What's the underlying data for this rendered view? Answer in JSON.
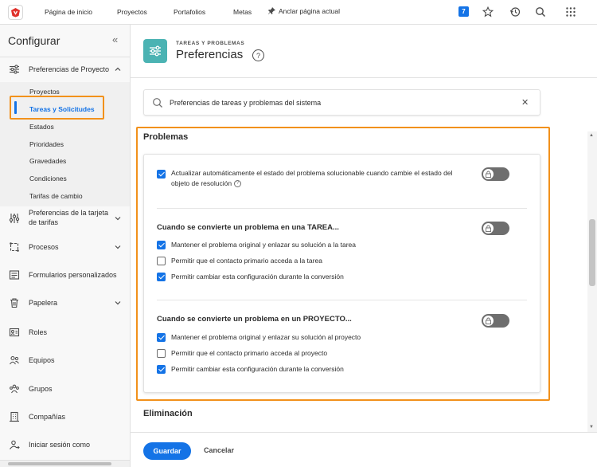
{
  "topnav": {
    "items": [
      "Página de inicio",
      "Proyectos",
      "Portafolios",
      "Metas"
    ],
    "pin_label": "Anclar página actual",
    "notification_count": "7"
  },
  "sidebar": {
    "title": "Configurar",
    "groups": [
      {
        "label": "Preferencias de Proyecto",
        "icon": "sliders-icon"
      },
      {
        "label": "Preferencias de la tarjeta de tarifas",
        "icon": "sliders-vertical-icon"
      },
      {
        "label": "Procesos",
        "icon": "process-icon"
      },
      {
        "label": "Formularios personalizados",
        "icon": "form-icon"
      },
      {
        "label": "Papelera",
        "icon": "trash-icon"
      },
      {
        "label": "Roles",
        "icon": "roles-icon"
      },
      {
        "label": "Equipos",
        "icon": "teams-icon"
      },
      {
        "label": "Grupos",
        "icon": "groups-icon"
      },
      {
        "label": "Compañías",
        "icon": "building-icon"
      },
      {
        "label": "Iniciar sesión como",
        "icon": "login-icon"
      }
    ],
    "subitems": [
      "Proyectos",
      "Tareas y Solicitudes",
      "Estados",
      "Prioridades",
      "Gravedades",
      "Condiciones",
      "Tarifas de cambio"
    ]
  },
  "header": {
    "kicker": "TAREAS Y PROBLEMAS",
    "title": "Preferencias",
    "help": "?"
  },
  "search": {
    "value": "Preferencias de tareas y problemas del sistema",
    "clear": "✕"
  },
  "problems": {
    "title": "Problemas",
    "auto_update": {
      "label_line1": "Actualizar automáticamente el estado del problema solucionable cuando cambie el estado del",
      "label_line2": "objeto de resolución",
      "checked": true
    },
    "task_section": {
      "heading": "Cuando se convierte un problema en una TAREA...",
      "options": [
        {
          "label": "Mantener el problema original y enlazar su solución a la tarea",
          "checked": true
        },
        {
          "label": "Permitir que el contacto primario acceda a la tarea",
          "checked": false
        },
        {
          "label": "Permitir cambiar esta configuración durante la conversión",
          "checked": true
        }
      ]
    },
    "project_section": {
      "heading": "Cuando se convierte un problema en un PROYECTO...",
      "options": [
        {
          "label": "Mantener el problema original y enlazar su solución al proyecto",
          "checked": true
        },
        {
          "label": "Permitir que el contacto primario acceda al proyecto",
          "checked": false
        },
        {
          "label": "Permitir cambiar esta configuración durante la conversión",
          "checked": true
        }
      ]
    }
  },
  "elimination": {
    "title": "Eliminación"
  },
  "footer": {
    "save": "Guardar",
    "cancel": "Cancelar"
  },
  "colors": {
    "accent": "#1473e6",
    "highlight": "#f2911b",
    "header_icon": "#4bb3b3"
  }
}
